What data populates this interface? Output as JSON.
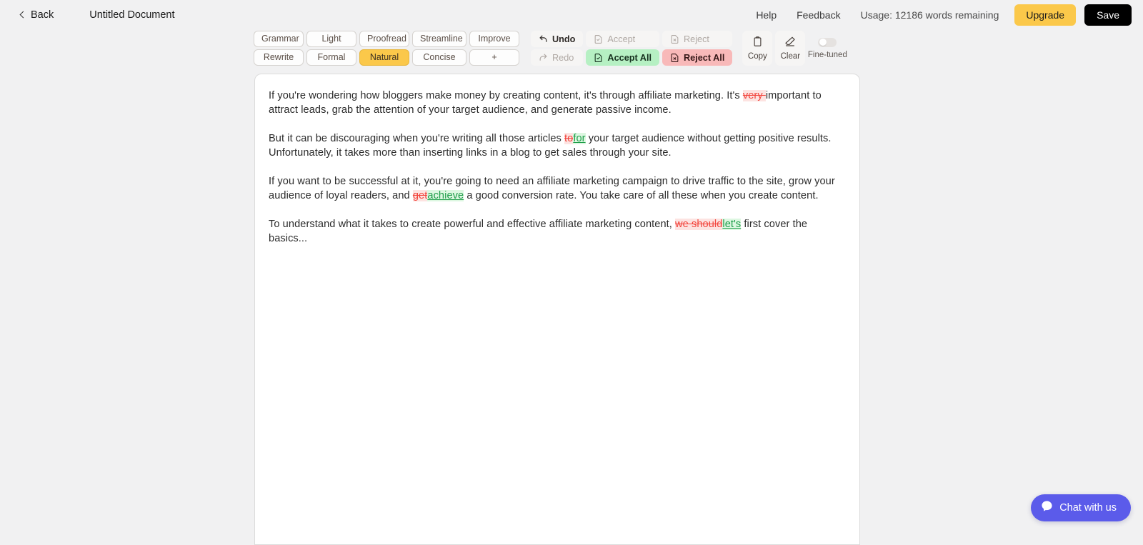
{
  "header": {
    "back_label": "Back",
    "document_title": "Untitled Document",
    "help_label": "Help",
    "feedback_label": "Feedback",
    "usage_label": "Usage: 12186 words remaining",
    "upgrade_label": "Upgrade",
    "save_label": "Save",
    "accent_yellow": "#fbc84a",
    "save_bg": "#000000"
  },
  "toolbar": {
    "styles": [
      {
        "label": "Grammar",
        "active": false
      },
      {
        "label": "Light",
        "active": false
      },
      {
        "label": "Proofread",
        "active": false
      },
      {
        "label": "Streamline",
        "active": false
      },
      {
        "label": "Improve",
        "active": false
      },
      {
        "label": "Rewrite",
        "active": false
      },
      {
        "label": "Formal",
        "active": false
      },
      {
        "label": "Natural",
        "active": true
      },
      {
        "label": "Concise",
        "active": false
      },
      {
        "label": "+",
        "active": false
      }
    ],
    "actions": {
      "undo": "Undo",
      "accept": "Accept",
      "reject": "Reject",
      "redo": "Redo",
      "accept_all": "Accept All",
      "reject_all": "Reject All",
      "accept_all_bg": "#b6f0c3",
      "reject_all_bg": "#f8b9b9"
    },
    "icon_buttons": {
      "copy": "Copy",
      "clear": "Clear",
      "fine_tuned": "Fine-tuned",
      "fine_tuned_on": false
    }
  },
  "document": {
    "paragraphs": [
      {
        "parts": [
          {
            "type": "text",
            "value": "If you're wondering how bloggers make money by creating content, it's through affiliate marketing. It's "
          },
          {
            "type": "del",
            "value": "very "
          },
          {
            "type": "text",
            "value": "important to attract leads, grab the attention of your target audience, and generate passive income."
          }
        ]
      },
      {
        "parts": [
          {
            "type": "text",
            "value": "But it can be discouraging when you're writing all those articles "
          },
          {
            "type": "del",
            "value": "to"
          },
          {
            "type": "ins",
            "value": "for"
          },
          {
            "type": "text",
            "value": " your target audience without getting positive results. Unfortunately, it takes more than inserting links in a blog to get sales through your site."
          }
        ]
      },
      {
        "parts": [
          {
            "type": "text",
            "value": "If you want to be successful at it, you're going to need an affiliate marketing campaign to drive traffic to the site, grow your audience of loyal readers, and "
          },
          {
            "type": "del",
            "value": "get"
          },
          {
            "type": "ins",
            "value": "achieve"
          },
          {
            "type": "text",
            "value": " a good conversion rate. You take care of all these when you create content."
          }
        ]
      },
      {
        "parts": [
          {
            "type": "text",
            "value": "To understand what it takes to create powerful and effective affiliate marketing content, "
          },
          {
            "type": "del",
            "value": "we should"
          },
          {
            "type": "ins",
            "value": "let's"
          },
          {
            "type": "text",
            "value": " first cover the basics..."
          }
        ]
      }
    ]
  },
  "chat": {
    "label": "Chat with us",
    "color": "#5b5bea"
  }
}
